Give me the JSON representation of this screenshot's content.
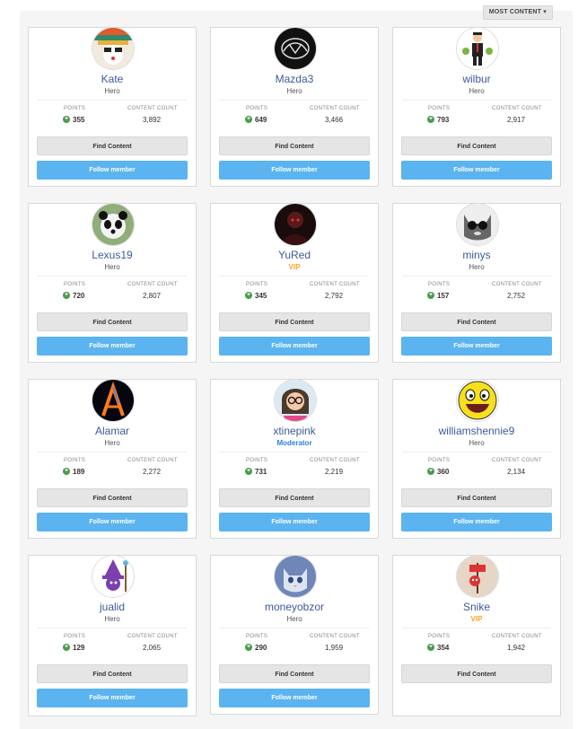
{
  "sort": {
    "label": "MOST CONTENT",
    "caret": "▾"
  },
  "labels": {
    "points": "POINTS",
    "content_count": "CONTENT COUNT",
    "find_content": "Find Content",
    "follow_member": "Follow member"
  },
  "members": [
    {
      "name": "Kate",
      "role": "Hero",
      "points": "355",
      "content_count": "3,892",
      "avatar": "knitted-hat-avatar-icon"
    },
    {
      "name": "Mazda3",
      "role": "Hero",
      "points": "649",
      "content_count": "3,466",
      "avatar": "mazda-logo-avatar-icon"
    },
    {
      "name": "wilbur",
      "role": "Hero",
      "points": "793",
      "content_count": "2,917",
      "avatar": "businessman-avatar-icon"
    },
    {
      "name": "Lexus19",
      "role": "Hero",
      "points": "720",
      "content_count": "2,807",
      "avatar": "panda-avatar-icon"
    },
    {
      "name": "YuRed",
      "role": "VIP",
      "points": "345",
      "content_count": "2,792",
      "avatar": "dark-figure-avatar-icon"
    },
    {
      "name": "minys",
      "role": "Hero",
      "points": "157",
      "content_count": "2,752",
      "avatar": "cat-sunglasses-avatar-icon"
    },
    {
      "name": "Alamar",
      "role": "Hero",
      "points": "189",
      "content_count": "2,272",
      "avatar": "fire-letter-a-avatar-icon"
    },
    {
      "name": "xtinepink",
      "role": "Moderator",
      "points": "731",
      "content_count": "2,219",
      "avatar": "cartoon-girl-avatar-icon"
    },
    {
      "name": "williamshennie9",
      "role": "Hero",
      "points": "360",
      "content_count": "2,134",
      "avatar": "smiley-face-avatar-icon"
    },
    {
      "name": "jualid",
      "role": "Hero",
      "points": "129",
      "content_count": "2,065",
      "avatar": "wizard-avatar-icon"
    },
    {
      "name": "moneyobzor",
      "role": "Hero",
      "points": "290",
      "content_count": "1,959",
      "avatar": "kitten-avatar-icon"
    },
    {
      "name": "Snike",
      "role": "VIP",
      "points": "354",
      "content_count": "1,942",
      "avatar": "cartoon-sign-avatar-icon"
    }
  ],
  "colors": {
    "link": "#3d5a99",
    "follow": "#5bb4f0",
    "vip": "#f5a623",
    "moderator": "#2f7fe0",
    "points_icon": "#4a9a4a"
  }
}
